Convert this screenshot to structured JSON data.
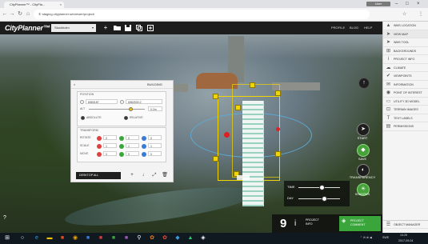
{
  "browser": {
    "tab_title": "CityPlanner™ - CityPla...",
    "tab_close": "×",
    "user_badge": "User",
    "window_controls": [
      "–",
      "□",
      "×"
    ],
    "url": "① staging.cityplanner.se/viewer/project/",
    "nav": {
      "back": "←",
      "forward": "→",
      "reload": "↻",
      "home": "⌂"
    },
    "right_icons": [
      "☆",
      "⋮"
    ]
  },
  "app": {
    "logo": "CityPlanner™",
    "project_select": "Stockholm",
    "menu": [
      "PROFILE",
      "BLOG",
      "HELP"
    ],
    "toolbar_icons": [
      "+",
      "folder",
      "save",
      "copy",
      "copy2"
    ]
  },
  "panel": {
    "header_title": "BUILDING",
    "position_title": "POSITION",
    "pos_fields": [
      "6583187",
      "6582533.2"
    ],
    "alt_label": "ALT",
    "alt_value": "0.2m",
    "alt_fill": 0.75,
    "absolute": "ABSOLUTE",
    "relative": "RELATIVE",
    "transform_title": "TRANSFORM",
    "rows": [
      {
        "label": "ROTATE",
        "values": [
          "0",
          "0",
          "0"
        ]
      },
      {
        "label": "SCALE",
        "values": [
          "1",
          "1",
          "1"
        ]
      },
      {
        "label": "MOVE",
        "values": [
          "0",
          "0",
          "0"
        ]
      }
    ],
    "footer_button": "DESKTOP ALL",
    "footer_icons": [
      "+",
      "↓",
      "⤢",
      "🗑"
    ]
  },
  "sun": {
    "time_label": "TIME",
    "day_label": "DAY",
    "time_value": 0.55,
    "day_value": 0.6
  },
  "scene_buttons": {
    "start": "START",
    "save": "SAVE",
    "transparency": "TRANSPARENCY",
    "shadows": "SHADOWS"
  },
  "bottom": {
    "count": "9",
    "project_label": "PROJECT\nINFO",
    "green_label": "PROJECT\nCOMMENT"
  },
  "right_panel": {
    "items": [
      {
        "icon": "▲",
        "label": "WMS LOCATION"
      },
      {
        "icon": "➤",
        "label": "VIEW MAP"
      },
      {
        "icon": "➤",
        "label": "WMS TOOL"
      },
      {
        "icon": "⊞",
        "label": "BACKGROUNDS"
      },
      {
        "icon": "i",
        "label": "PROJECT INFO"
      },
      {
        "icon": "☁",
        "label": "CLIMATE"
      },
      {
        "icon": "✔",
        "label": "VIEWPOINTS"
      },
      {
        "icon": "✉",
        "label": "INFORMATION"
      },
      {
        "icon": "◉",
        "label": "POINT OF INTEREST"
      },
      {
        "icon": "▭",
        "label": "UTILITY 3D MODEL"
      },
      {
        "icon": "⊡",
        "label": "TERRAIN IMAGES"
      },
      {
        "icon": "T",
        "label": "TEXT LABELS"
      },
      {
        "icon": "▤",
        "label": "PERMISSIONS"
      }
    ],
    "bottom_item": "OBJECT MANAGER",
    "bottom_icon": "☰"
  },
  "taskbar": {
    "tray_time": "13:25",
    "tray_date": "2017-09-04",
    "tray_lang": "SWE",
    "help_icon": "?"
  },
  "colors": {
    "accent_yellow": "#f2d400",
    "green": "#3aa53a",
    "dark_toolbar": "#1d1d1d"
  }
}
